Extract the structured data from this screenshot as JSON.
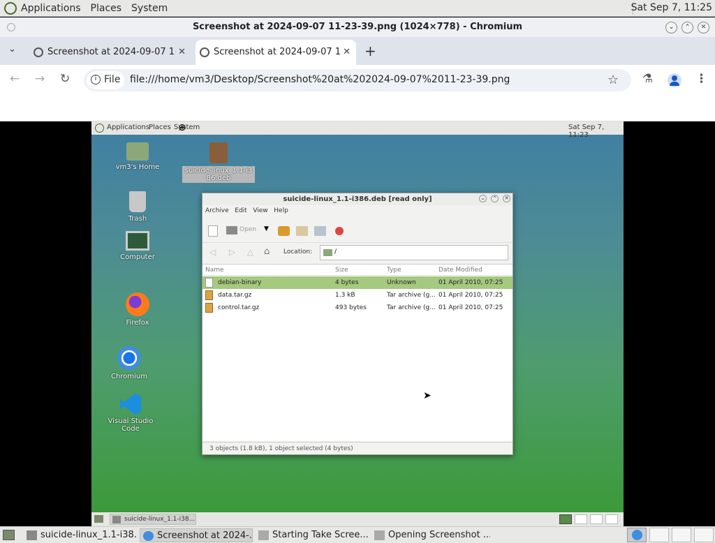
{
  "top_panel": {
    "applications": "Applications",
    "places": "Places",
    "system": "System",
    "clock": "Sat Sep  7, 11:25"
  },
  "browser": {
    "window_title": "Screenshot at 2024-09-07 11-23-39.png (1024×778) - Chromium",
    "tabs": [
      {
        "label": "Screenshot at 2024-09-07 1",
        "active": false
      },
      {
        "label": "Screenshot at 2024-09-07 1",
        "active": true
      }
    ],
    "new_tab": "+",
    "omnibox": {
      "chip": "File",
      "url": "file:///home/vm3/Desktop/Screenshot%20at%202024-09-07%2011-23-39.png"
    }
  },
  "shot": {
    "panel": {
      "applications": "Applications",
      "places": "Places",
      "system": "System",
      "clock": "Sat Sep  7, 11:23"
    },
    "desktop_icons": [
      {
        "label": "vm3's Home",
        "icon": "folder-home-icon"
      },
      {
        "label": "suicide-linux_1.1-i386.deb",
        "icon": "package-icon"
      },
      {
        "label": "Trash",
        "icon": "trash-icon"
      },
      {
        "label": "Computer",
        "icon": "computer-icon"
      },
      {
        "label": "Firefox",
        "icon": "firefox-icon"
      },
      {
        "label": "Chromium",
        "icon": "chromium-icon"
      },
      {
        "label": "Visual Studio Code",
        "icon": "vscode-icon"
      }
    ],
    "archive_window": {
      "title": "suicide-linux_1.1-i386.deb [read only]",
      "menu": [
        "Archive",
        "Edit",
        "View",
        "Help"
      ],
      "open_label": "Open",
      "location_label": "Location:",
      "location_value": "/",
      "columns": [
        "Name",
        "Size",
        "Type",
        "Date Modified"
      ],
      "rows": [
        {
          "name": "debian-binary",
          "size": "4 bytes",
          "type": "Unknown",
          "date": "01 April 2010, 07:25",
          "selected": true
        },
        {
          "name": "data.tar.gz",
          "size": "1.3 kB",
          "type": "Tar archive (g...",
          "date": "01 April 2010, 07:25",
          "selected": false
        },
        {
          "name": "control.tar.gz",
          "size": "493 bytes",
          "type": "Tar archive (g...",
          "date": "01 April 2010, 07:25",
          "selected": false
        }
      ],
      "status": "3 objects (1.8 kB), 1 object selected (4 bytes)"
    },
    "taskbar_item": "suicide-linux_1.1-i38..."
  },
  "bottom_panel": {
    "tasks": [
      {
        "label": "suicide-linux_1.1-i38..."
      },
      {
        "label": "Screenshot at 2024-..."
      },
      {
        "label": "Starting Take Scree..."
      },
      {
        "label": "Opening Screenshot ..."
      }
    ]
  },
  "colors": {
    "selection": "#a5c97e",
    "chrome_tabstrip": "#dfe3eb",
    "panel": "#e8e8e7"
  }
}
